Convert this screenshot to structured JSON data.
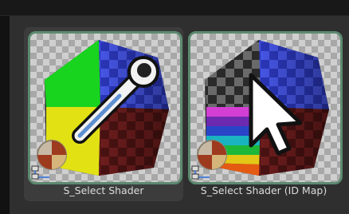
{
  "assets": [
    {
      "label": "S_Select Shader",
      "icon": "eyedropper-icon",
      "selected": true
    },
    {
      "label": "S_Select Shader (ID Map)",
      "icon": "mouse-pointer-icon",
      "selected": false
    }
  ],
  "colors": {
    "selection_border": "#5c8a6f",
    "panel_bg": "#2f2f2f",
    "selected_tile_bg": "#3c3c3c",
    "label_text": "#dcdcdc"
  }
}
